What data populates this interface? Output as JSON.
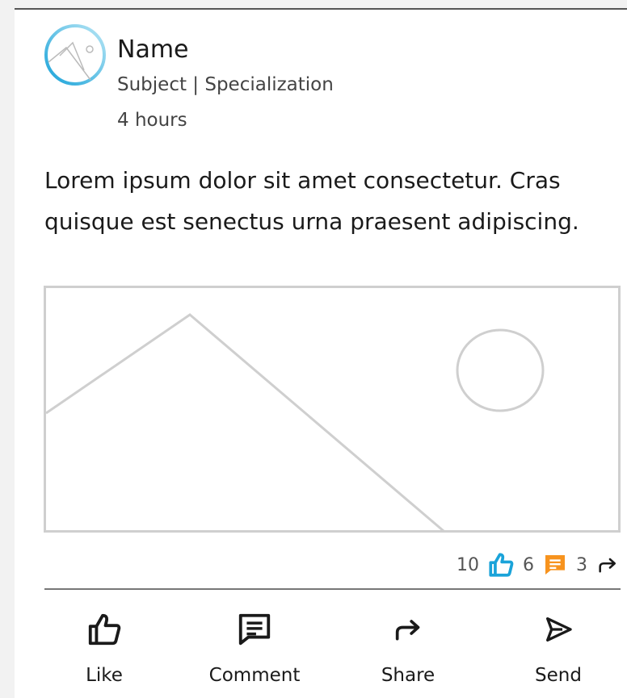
{
  "post": {
    "author_name": "Name",
    "author_subtitle": "Subject | Specialization",
    "timestamp": "4  hours",
    "body": "Lorem ipsum dolor sit amet consectetur. Cras quisque est senectus urna praesent adipiscing.",
    "avatar_icon": "image-placeholder-icon",
    "media_icon": "image-placeholder"
  },
  "stats": {
    "likes": "10",
    "comments": "6",
    "shares": "3",
    "like_icon": "thumbs-up-icon",
    "comment_icon": "comment-icon",
    "share_icon": "share-arrow-icon",
    "like_color": "#1aa3d9",
    "comment_color": "#f7931e"
  },
  "actions": [
    {
      "label": "Like",
      "icon": "thumbs-up-icon"
    },
    {
      "label": "Comment",
      "icon": "comment-icon"
    },
    {
      "label": "Share",
      "icon": "share-arrow-icon"
    },
    {
      "label": "Send",
      "icon": "send-icon"
    }
  ]
}
